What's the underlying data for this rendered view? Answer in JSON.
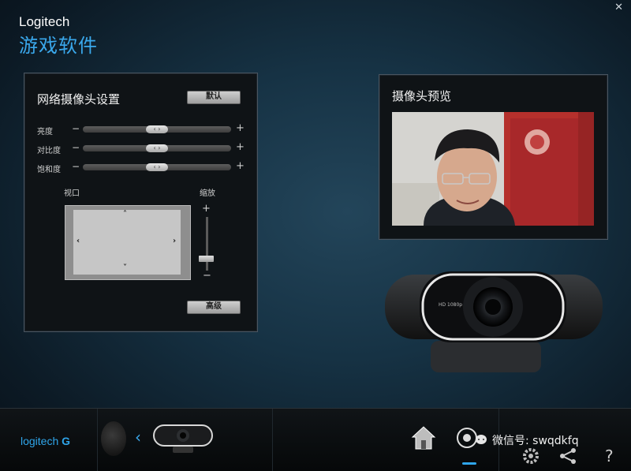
{
  "app": {
    "brand": "Logitech",
    "title": "游戏软件"
  },
  "settings": {
    "title": "网络摄像头设置",
    "default_button": "默认",
    "sliders": [
      {
        "label": "亮度",
        "level_percent": 50
      },
      {
        "label": "对比度",
        "level_percent": 50
      },
      {
        "label": "饱和度",
        "level_percent": 50
      }
    ],
    "viewport_label": "视口",
    "zoom_label": "缩放",
    "zoom_level_percent": 15,
    "advanced_button": "高级"
  },
  "preview": {
    "title": "摄像头预览"
  },
  "camera": {
    "model_text": "HD 1080p"
  },
  "footer": {
    "logo": "logitech",
    "watermark": "微信号: swqdkfq"
  },
  "colors": {
    "accent": "#2fa5ea",
    "panel_bg": "#0f1316",
    "title_blue": "#3aa8ec"
  },
  "icons": [
    "close-icon",
    "back-arrow-icon",
    "home-icon",
    "camera-icon",
    "gear-icon",
    "share-icon",
    "help-icon",
    "chat-icon"
  ]
}
